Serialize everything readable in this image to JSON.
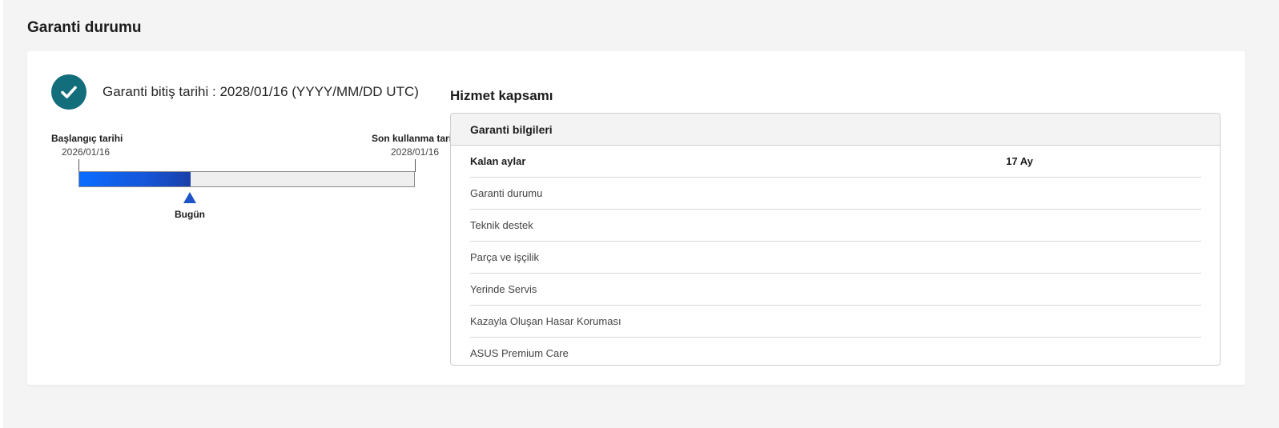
{
  "section_title": "Garanti durumu",
  "expiry": {
    "text": "Garanti bitiş tarihi : 2028/01/16 (YYYY/MM/DD UTC)",
    "status_icon": "check-circle-icon",
    "status_color": "#116e7a"
  },
  "timeline": {
    "start_label": "Başlangıç tarihi",
    "start_date": "2026/01/16",
    "end_label": "Son kullanma tarihi",
    "end_date": "2028/01/16",
    "today_label": "Bugün",
    "elapsed_fraction": 0.33,
    "fill_color": "#0a6cff"
  },
  "coverage": {
    "title": "Hizmet kapsamı",
    "header": "Garanti bilgileri",
    "rows": [
      {
        "label": "Kalan aylar",
        "value": "17 Ay",
        "type": "text",
        "bold": true
      },
      {
        "label": "Garanti durumu",
        "type": "check"
      },
      {
        "label": "Teknik destek",
        "type": "check"
      },
      {
        "label": "Parça ve işçilik",
        "type": "check"
      },
      {
        "label": "Yerinde Servis",
        "type": "cross"
      },
      {
        "label": "Kazayla Oluşan Hasar Koruması",
        "type": "cross"
      },
      {
        "label": "ASUS Premium Care",
        "type": "cross"
      }
    ],
    "check_color": "#12808a",
    "cross_color": "#111111"
  }
}
